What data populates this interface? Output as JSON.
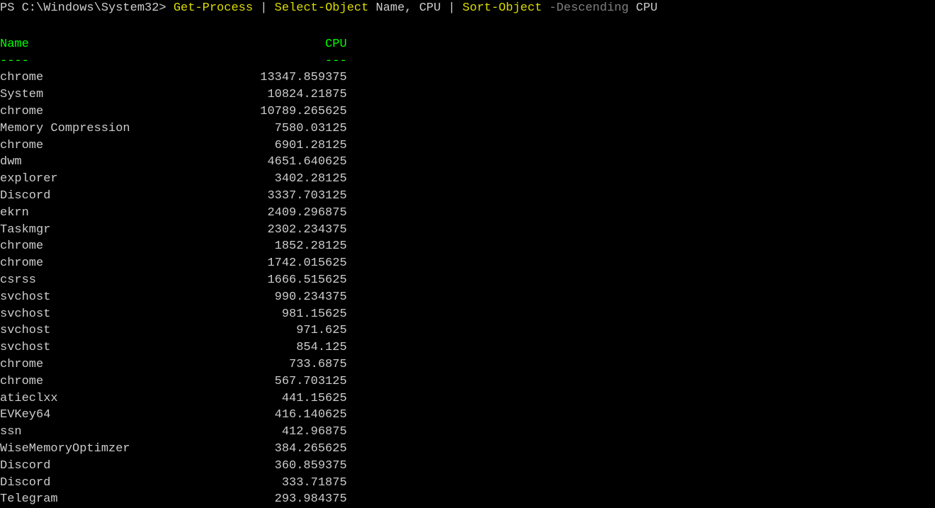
{
  "prompt": {
    "prefix": "PS C:\\Windows\\System32> ",
    "cmd1": "Get-Process",
    "pipe1": " | ",
    "cmd2": "Select-Object",
    "args2": " Name, CPU ",
    "pipe2": "| ",
    "cmd3": "Sort-Object",
    "switch": " -Descending ",
    "arg3": "CPU"
  },
  "headers": {
    "name": "Name",
    "cpu": "CPU"
  },
  "dividers": {
    "name": "----",
    "cpu": "---"
  },
  "rows": [
    {
      "name": "chrome",
      "cpu": "13347.859375"
    },
    {
      "name": "System",
      "cpu": "10824.21875"
    },
    {
      "name": "chrome",
      "cpu": "10789.265625"
    },
    {
      "name": "Memory Compression",
      "cpu": "7580.03125"
    },
    {
      "name": "chrome",
      "cpu": "6901.28125"
    },
    {
      "name": "dwm",
      "cpu": "4651.640625"
    },
    {
      "name": "explorer",
      "cpu": "3402.28125"
    },
    {
      "name": "Discord",
      "cpu": "3337.703125"
    },
    {
      "name": "ekrn",
      "cpu": "2409.296875"
    },
    {
      "name": "Taskmgr",
      "cpu": "2302.234375"
    },
    {
      "name": "chrome",
      "cpu": "1852.28125"
    },
    {
      "name": "chrome",
      "cpu": "1742.015625"
    },
    {
      "name": "csrss",
      "cpu": "1666.515625"
    },
    {
      "name": "svchost",
      "cpu": "990.234375"
    },
    {
      "name": "svchost",
      "cpu": "981.15625"
    },
    {
      "name": "svchost",
      "cpu": "971.625"
    },
    {
      "name": "svchost",
      "cpu": "854.125"
    },
    {
      "name": "chrome",
      "cpu": "733.6875"
    },
    {
      "name": "chrome",
      "cpu": "567.703125"
    },
    {
      "name": "atieclxx",
      "cpu": "441.15625"
    },
    {
      "name": "EVKey64",
      "cpu": "416.140625"
    },
    {
      "name": "ssn",
      "cpu": "412.96875"
    },
    {
      "name": "WiseMemoryOptimzer",
      "cpu": "384.265625"
    },
    {
      "name": "Discord",
      "cpu": "360.859375"
    },
    {
      "name": "Discord",
      "cpu": "333.71875"
    },
    {
      "name": "Telegram",
      "cpu": "293.984375"
    }
  ]
}
